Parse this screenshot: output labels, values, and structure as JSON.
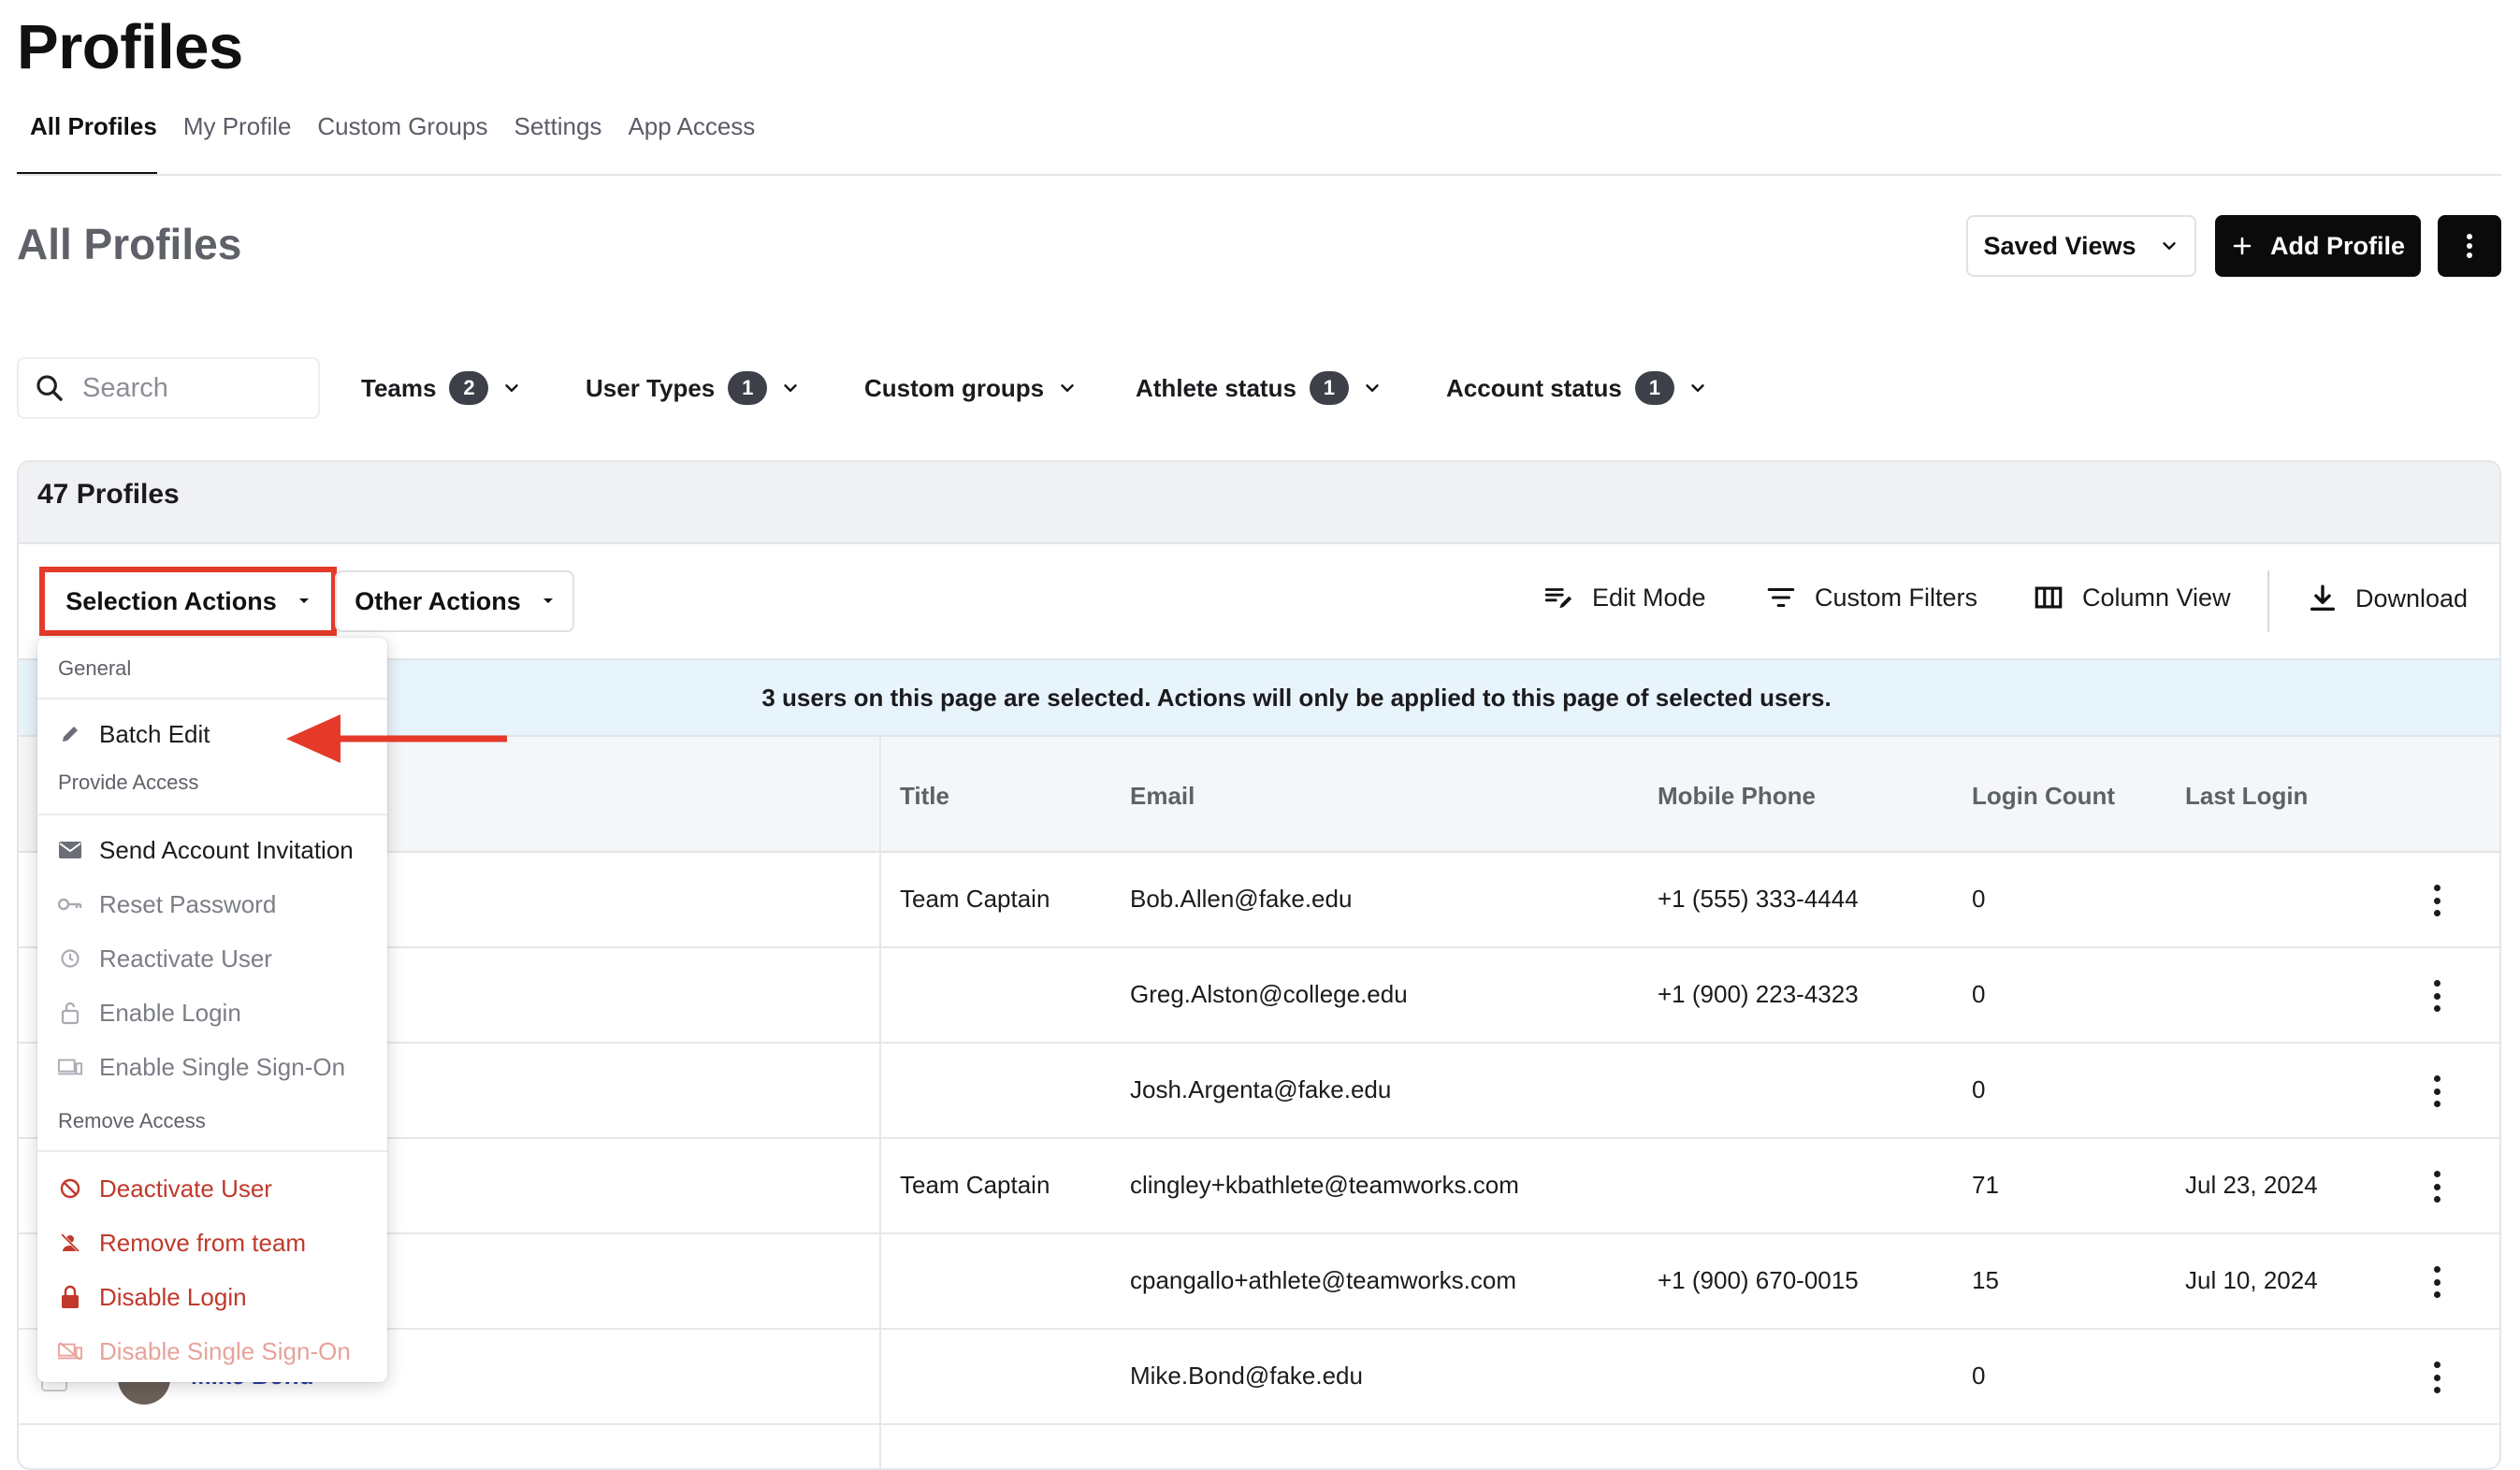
{
  "page": {
    "title": "Profiles",
    "tabs": [
      {
        "label": "All Profiles",
        "active": true
      },
      {
        "label": "My Profile"
      },
      {
        "label": "Custom Groups"
      },
      {
        "label": "Settings"
      },
      {
        "label": "App Access"
      }
    ],
    "section_title": "All Profiles",
    "saved_views_label": "Saved Views",
    "add_profile_label": "Add Profile"
  },
  "filters": {
    "search_placeholder": "Search",
    "items": [
      {
        "label": "Teams",
        "count": "2"
      },
      {
        "label": "User Types",
        "count": "1"
      },
      {
        "label": "Custom groups",
        "count": ""
      },
      {
        "label": "Athlete status",
        "count": "1"
      },
      {
        "label": "Account status",
        "count": "1"
      }
    ]
  },
  "card": {
    "count_label": "47 Profiles",
    "selection_actions_label": "Selection Actions",
    "other_actions_label": "Other Actions",
    "edit_mode_label": "Edit Mode",
    "custom_filters_label": "Custom Filters",
    "column_view_label": "Column View",
    "download_label": "Download",
    "info_message": "3 users on this page are selected. Actions will only be applied to this page of selected users."
  },
  "table": {
    "columns": [
      "Title",
      "Email",
      "Mobile Phone",
      "Login Count",
      "Last Login"
    ],
    "rows": [
      {
        "title": "Team Captain",
        "email": "Bob.Allen@fake.edu",
        "phone": "+1 (555) 333-4444",
        "login_count": "0",
        "last_login": ""
      },
      {
        "title": "",
        "email": "Greg.Alston@college.edu",
        "phone": "+1 (900) 223-4323",
        "login_count": "0",
        "last_login": ""
      },
      {
        "title": "",
        "email": "Josh.Argenta@fake.edu",
        "phone": "",
        "login_count": "0",
        "last_login": ""
      },
      {
        "title": "Team Captain",
        "email": "clingley+kbathlete@teamworks.com",
        "phone": "",
        "login_count": "71",
        "last_login": "Jul 23, 2024"
      },
      {
        "title": "",
        "email": "cpangallo+athlete@teamworks.com",
        "phone": "+1 (900) 670-0015",
        "login_count": "15",
        "last_login": "Jul 10, 2024"
      },
      {
        "title": "",
        "email": "Mike.Bond@fake.edu",
        "phone": "",
        "login_count": "0",
        "last_login": "",
        "partial_name": "Mike Bond"
      }
    ]
  },
  "menu": {
    "groups": {
      "general": "General",
      "provide_access": "Provide Access",
      "remove_access": "Remove Access"
    },
    "items": {
      "batch_edit": "Batch Edit",
      "send_invitation": "Send Account Invitation",
      "reset_password": "Reset Password",
      "reactivate_user": "Reactivate User",
      "enable_login": "Enable Login",
      "enable_sso": "Enable Single Sign-On",
      "deactivate_user": "Deactivate User",
      "remove_from_team": "Remove from team",
      "disable_login": "Disable Login",
      "disable_sso": "Disable Single Sign-On"
    }
  },
  "colors": {
    "annotation_red": "#e53a2a",
    "danger": "#c0392b",
    "info_bg": "#e8f4fb",
    "primary_button": "#0b0b0c"
  }
}
